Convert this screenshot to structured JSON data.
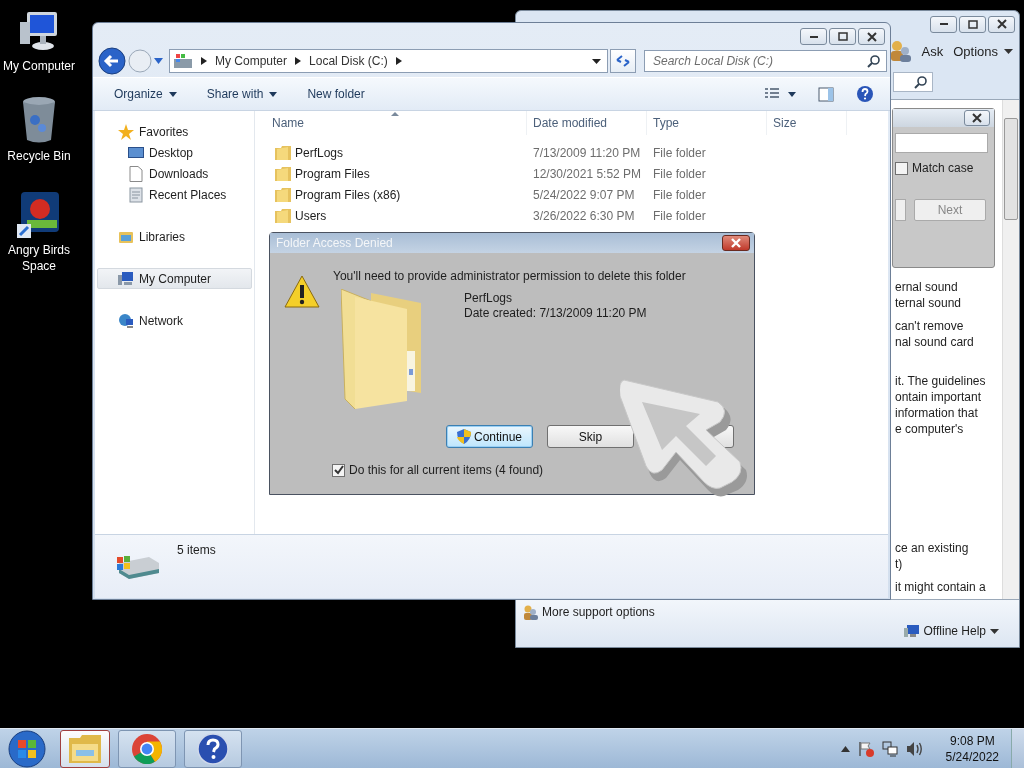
{
  "desktop_icons": [
    {
      "label": "My Computer",
      "kind": "computer"
    },
    {
      "label": "Recycle Bin",
      "kind": "bin"
    },
    {
      "label": "Angry Birds Space",
      "kind": "game"
    }
  ],
  "help_window": {
    "toolbar": [
      {
        "label": "Ask",
        "has_menu": false
      },
      {
        "label": "Options",
        "has_menu": true
      }
    ],
    "find_panel": {
      "match_case": {
        "label": "Match case",
        "checked": false
      },
      "next_button": "Next"
    },
    "paragraphs": [
      [
        "ernal sound",
        "ternal sound"
      ],
      [
        "can't remove",
        "nal sound card"
      ],
      [
        "it. The guidelines",
        "ontain important",
        "information that",
        "e computer's"
      ],
      [
        "ce an existing",
        "t)"
      ],
      [
        "it might contain a"
      ]
    ],
    "footer": {
      "support_link": "More support options",
      "offline_menu": "Offline Help"
    }
  },
  "explorer": {
    "breadcrumb": [
      "My Computer",
      "Local Disk (C:)"
    ],
    "search": {
      "placeholder": "Search Local Disk (C:)"
    },
    "toolbar": [
      {
        "label": "Organize",
        "has_menu": true
      },
      {
        "label": "Share with",
        "has_menu": true
      },
      {
        "label": "New folder",
        "has_menu": false
      }
    ],
    "nav": [
      {
        "label": "Favorites",
        "kind": "star",
        "selected": false,
        "children": [
          {
            "label": "Desktop",
            "kind": "desktop",
            "selected": false
          },
          {
            "label": "Downloads",
            "kind": "file",
            "selected": false
          },
          {
            "label": "Recent Places",
            "kind": "recent",
            "selected": false
          }
        ]
      },
      {
        "label": "Libraries",
        "kind": "library",
        "selected": false
      },
      {
        "label": "My Computer",
        "kind": "computer",
        "selected": true
      },
      {
        "label": "Network",
        "kind": "network",
        "selected": false
      }
    ],
    "columns": [
      {
        "label": "Name",
        "sorted": true
      },
      {
        "label": "Date modified",
        "sorted": false
      },
      {
        "label": "Type",
        "sorted": false
      },
      {
        "label": "Size",
        "sorted": false
      }
    ],
    "rows": [
      {
        "name": "PerfLogs",
        "date": "7/13/2009 11:20 PM",
        "type": "File folder"
      },
      {
        "name": "Program Files",
        "date": "12/30/2021 5:52 PM",
        "type": "File folder"
      },
      {
        "name": "Program Files (x86)",
        "date": "5/24/2022 9:07 PM",
        "type": "File folder"
      },
      {
        "name": "Users",
        "date": "3/26/2022 6:30 PM",
        "type": "File folder"
      }
    ],
    "status": "5 items"
  },
  "dialog": {
    "title": "Folder Access Denied",
    "message": "You'll need to provide administrator permission to delete this folder",
    "item_name": "PerfLogs",
    "item_date": "Date created: 7/13/2009 11:20 PM",
    "buttons": [
      {
        "label": "Continue",
        "kind": "shield",
        "default": true
      },
      {
        "label": "Skip",
        "kind": "plain",
        "default": false
      }
    ],
    "apply_all": {
      "label": "Do this for all current items (4 found)",
      "checked": true
    }
  },
  "taskbar": {
    "apps": [
      {
        "kind": "explorer",
        "selected": true
      },
      {
        "kind": "browser",
        "selected": false
      },
      {
        "kind": "help",
        "selected": false
      }
    ],
    "time": "9:08 PM",
    "date": "5/24/2022"
  }
}
